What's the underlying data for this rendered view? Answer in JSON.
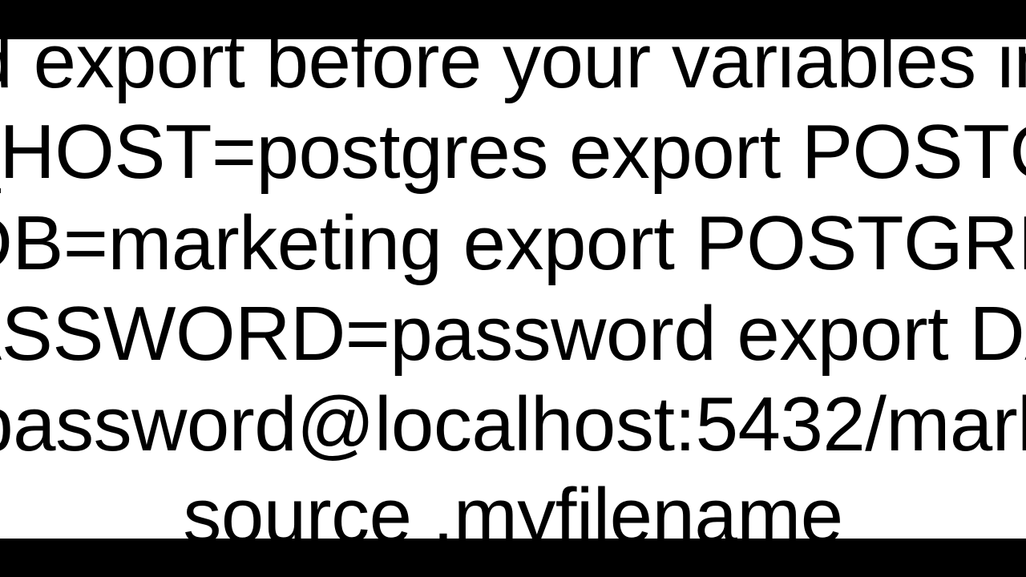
{
  "lines": {
    "l1": "d export before your variables in",
    "l2": "_HOST=postgres export POSTG",
    "l3": "DB=marketing export POSTGRE",
    "l4": "ASSWORD=password export DA",
    "l5": "password@localhost:5432/mark",
    "l6": "source .myfilename"
  }
}
